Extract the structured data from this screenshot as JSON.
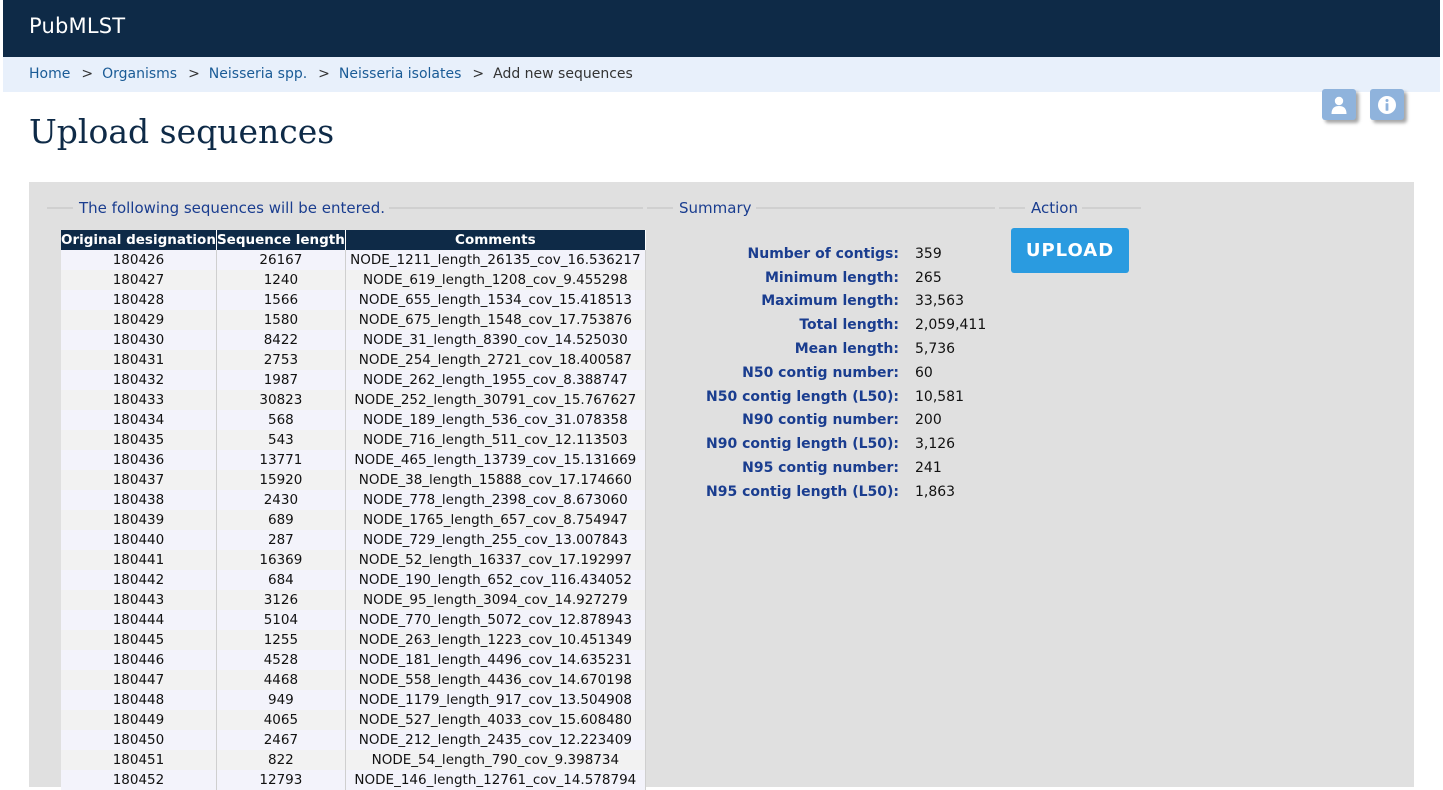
{
  "header": {
    "brand": "PubMLST"
  },
  "breadcrumb": {
    "items": [
      {
        "label": "Home"
      },
      {
        "label": "Organisms"
      },
      {
        "label": "Neisseria spp."
      },
      {
        "label": "Neisseria isolates"
      }
    ],
    "separator": ">",
    "current": "Add new sequences"
  },
  "toolbar_icons": [
    {
      "name": "user-icon"
    },
    {
      "name": "info-icon"
    }
  ],
  "page": {
    "title": "Upload sequences"
  },
  "sequences": {
    "legend": "The following sequences will be entered.",
    "columns": [
      "Original designation",
      "Sequence length",
      "Comments"
    ],
    "rows": [
      [
        "180426",
        "26167",
        "NODE_1211_length_26135_cov_16.536217"
      ],
      [
        "180427",
        "1240",
        "NODE_619_length_1208_cov_9.455298"
      ],
      [
        "180428",
        "1566",
        "NODE_655_length_1534_cov_15.418513"
      ],
      [
        "180429",
        "1580",
        "NODE_675_length_1548_cov_17.753876"
      ],
      [
        "180430",
        "8422",
        "NODE_31_length_8390_cov_14.525030"
      ],
      [
        "180431",
        "2753",
        "NODE_254_length_2721_cov_18.400587"
      ],
      [
        "180432",
        "1987",
        "NODE_262_length_1955_cov_8.388747"
      ],
      [
        "180433",
        "30823",
        "NODE_252_length_30791_cov_15.767627"
      ],
      [
        "180434",
        "568",
        "NODE_189_length_536_cov_31.078358"
      ],
      [
        "180435",
        "543",
        "NODE_716_length_511_cov_12.113503"
      ],
      [
        "180436",
        "13771",
        "NODE_465_length_13739_cov_15.131669"
      ],
      [
        "180437",
        "15920",
        "NODE_38_length_15888_cov_17.174660"
      ],
      [
        "180438",
        "2430",
        "NODE_778_length_2398_cov_8.673060"
      ],
      [
        "180439",
        "689",
        "NODE_1765_length_657_cov_8.754947"
      ],
      [
        "180440",
        "287",
        "NODE_729_length_255_cov_13.007843"
      ],
      [
        "180441",
        "16369",
        "NODE_52_length_16337_cov_17.192997"
      ],
      [
        "180442",
        "684",
        "NODE_190_length_652_cov_116.434052"
      ],
      [
        "180443",
        "3126",
        "NODE_95_length_3094_cov_14.927279"
      ],
      [
        "180444",
        "5104",
        "NODE_770_length_5072_cov_12.878943"
      ],
      [
        "180445",
        "1255",
        "NODE_263_length_1223_cov_10.451349"
      ],
      [
        "180446",
        "4528",
        "NODE_181_length_4496_cov_14.635231"
      ],
      [
        "180447",
        "4468",
        "NODE_558_length_4436_cov_14.670198"
      ],
      [
        "180448",
        "949",
        "NODE_1179_length_917_cov_13.504908"
      ],
      [
        "180449",
        "4065",
        "NODE_527_length_4033_cov_15.608480"
      ],
      [
        "180450",
        "2467",
        "NODE_212_length_2435_cov_12.223409"
      ],
      [
        "180451",
        "822",
        "NODE_54_length_790_cov_9.398734"
      ],
      [
        "180452",
        "12793",
        "NODE_146_length_12761_cov_14.578794"
      ]
    ]
  },
  "summary": {
    "legend": "Summary",
    "items": [
      {
        "label": "Number of contigs:",
        "value": "359"
      },
      {
        "label": "Minimum length:",
        "value": "265"
      },
      {
        "label": "Maximum length:",
        "value": "33,563"
      },
      {
        "label": "Total length:",
        "value": "2,059,411"
      },
      {
        "label": "Mean length:",
        "value": "5,736"
      },
      {
        "label": "N50 contig number:",
        "value": "60"
      },
      {
        "label": "N50 contig length (L50):",
        "value": "10,581"
      },
      {
        "label": "N90 contig number:",
        "value": "200"
      },
      {
        "label": "N90 contig length (L50):",
        "value": "3,126"
      },
      {
        "label": "N95 contig number:",
        "value": "241"
      },
      {
        "label": "N95 contig length (L50):",
        "value": "1,863"
      }
    ]
  },
  "action": {
    "legend": "Action",
    "upload_label": "UPLOAD"
  }
}
